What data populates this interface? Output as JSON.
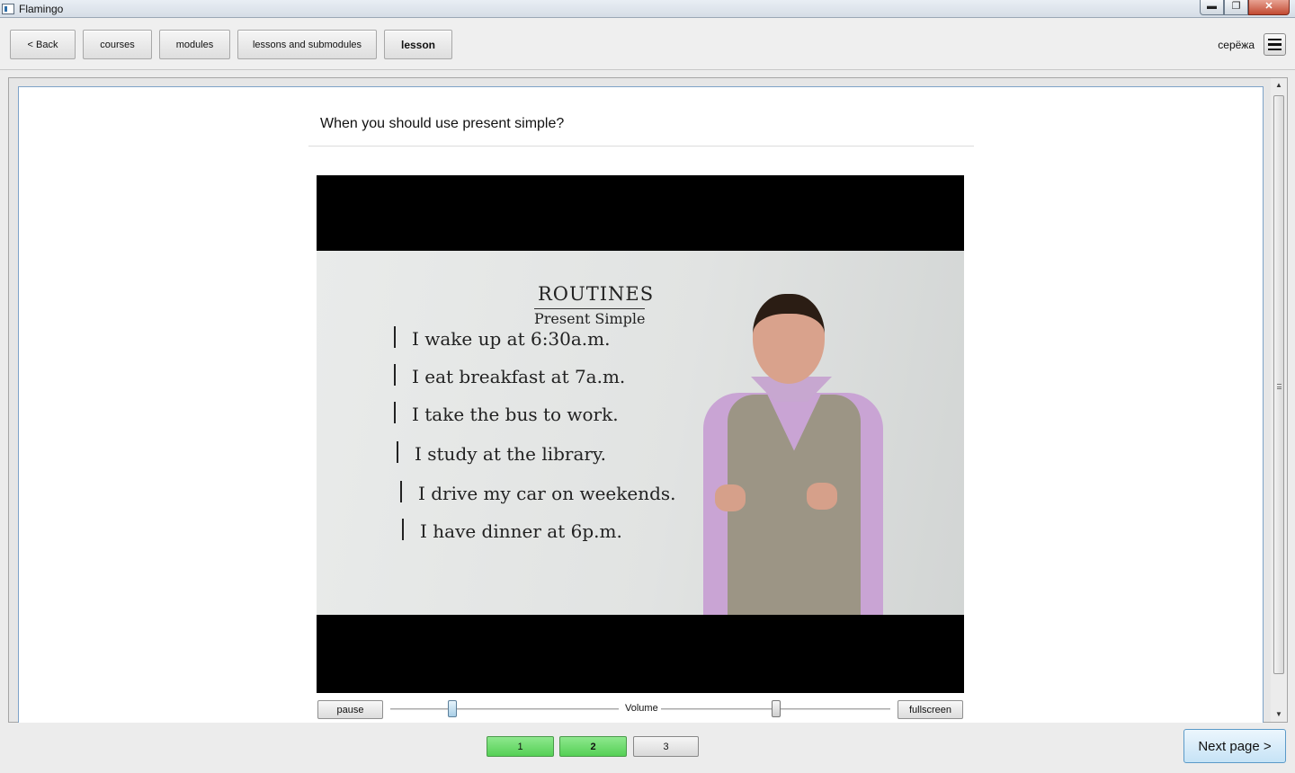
{
  "window": {
    "title": "Flamingo",
    "controls": [
      "minimize",
      "maximize",
      "close"
    ],
    "minimize_glyph": "▬",
    "maximize_glyph": "❐",
    "close_glyph": "✕"
  },
  "toolbar": {
    "back_label": "< Back",
    "courses_label": "courses",
    "modules_label": "modules",
    "lessons_label": "lessons and submodules",
    "lesson_label": "lesson",
    "user_name": "серёжа",
    "menu_icon": "hamburger-menu-icon"
  },
  "lesson": {
    "question": "When you should use present simple?"
  },
  "video": {
    "board_title": "ROUTINES",
    "board_subtitle": "Present Simple",
    "board_lines": [
      "I wake up at 6:30a.m.",
      "I eat breakfast at 7a.m.",
      "I take the bus to work.",
      "I study at the library.",
      "I drive my car on weekends.",
      "I have dinner at 6p.m."
    ],
    "controls": {
      "pause_label": "pause",
      "volume_label": "Volume",
      "fullscreen_label": "fullscreen",
      "position_fraction": 0.27,
      "volume_fraction": 0.5
    }
  },
  "pager": {
    "pages": [
      {
        "label": "1",
        "state": "visited"
      },
      {
        "label": "2",
        "state": "current"
      },
      {
        "label": "3",
        "state": "unvisited"
      }
    ],
    "next_label": "Next page >"
  },
  "colors": {
    "visited_page": "#66d866",
    "next_button": "#c6e3f6",
    "slider_handle": "#a9cfe6"
  }
}
